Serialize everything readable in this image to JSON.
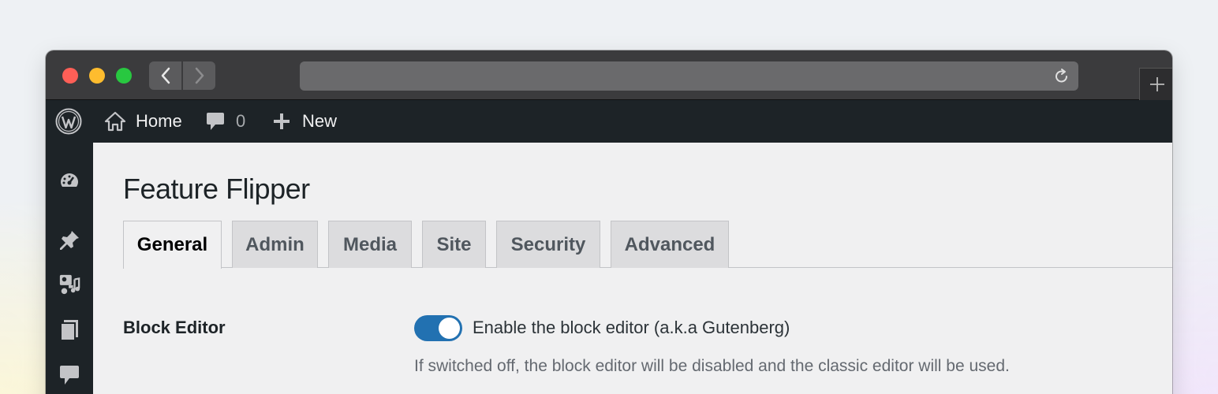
{
  "browser": {
    "icons": {
      "back": "chevron-left-icon",
      "forward": "chevron-right-icon",
      "reload": "reload-icon",
      "new_tab": "plus-icon"
    },
    "colors": {
      "close": "#fe5f57",
      "minimize": "#febc2e",
      "maximize": "#28c840"
    }
  },
  "admin_bar": {
    "home_label": "Home",
    "comments_count": "0",
    "new_label": "New"
  },
  "sidebar": {
    "icons": [
      "dashboard-icon",
      "pin-icon",
      "media-icon",
      "pages-icon",
      "comments-icon"
    ]
  },
  "page": {
    "title": "Feature Flipper",
    "tabs": [
      {
        "label": "General",
        "active": true
      },
      {
        "label": "Admin",
        "active": false
      },
      {
        "label": "Media",
        "active": false
      },
      {
        "label": "Site",
        "active": false
      },
      {
        "label": "Security",
        "active": false
      },
      {
        "label": "Advanced",
        "active": false
      }
    ],
    "settings": {
      "block_editor": {
        "label": "Block Editor",
        "enabled": true,
        "toggle_label": "Enable the block editor (a.k.a Gutenberg)",
        "description": "If switched off, the block editor will be disabled and the classic editor will be used."
      }
    }
  },
  "colors": {
    "accent": "#2271b1",
    "admin_bar": "#1d2327",
    "background": "#f0f0f1"
  }
}
